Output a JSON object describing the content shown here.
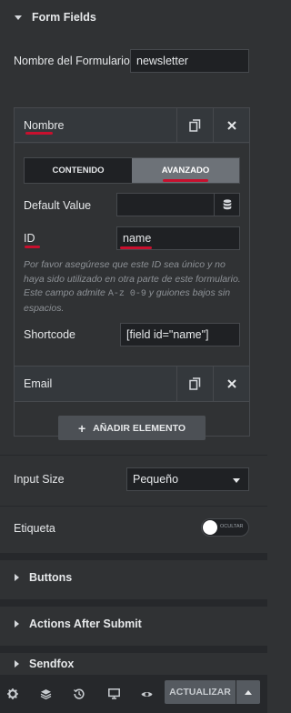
{
  "section_form_fields": {
    "title": "Form Fields"
  },
  "form_name": {
    "label": "Nombre del Formulario",
    "value": "newsletter"
  },
  "field_nombre": {
    "title": "Nombre",
    "tabs": {
      "content": "CONTENIDO",
      "advanced": "AVANZADO",
      "active": "advanced"
    },
    "default_value": {
      "label": "Default Value",
      "value": ""
    },
    "id": {
      "label": "ID",
      "value": "name"
    },
    "help_text": "Por favor asegúrese que este ID sea único y no haya sido utilizado en otra parte de este formulario. Este campo admite",
    "help_code": "A-z 0-9",
    "help_text_2": "y guiones bajos sin espacios.",
    "shortcode": {
      "label": "Shortcode",
      "value": "[field id=\"name\"]"
    }
  },
  "field_email": {
    "title": "Email"
  },
  "add_item": {
    "label": "AÑADIR ELEMENTO"
  },
  "input_size": {
    "label": "Input Size",
    "value": "Pequeño"
  },
  "etiqueta": {
    "label": "Etiqueta",
    "toggle_label": "OCULTAR"
  },
  "sections": {
    "buttons": "Buttons",
    "actions_after_submit": "Actions After Submit",
    "sendfox": "Sendfox"
  },
  "footer": {
    "update_label": "ACTUALIZAR"
  },
  "colors": {
    "accent": "#c8102e",
    "panel": "#303234",
    "input": "#1f2124"
  }
}
